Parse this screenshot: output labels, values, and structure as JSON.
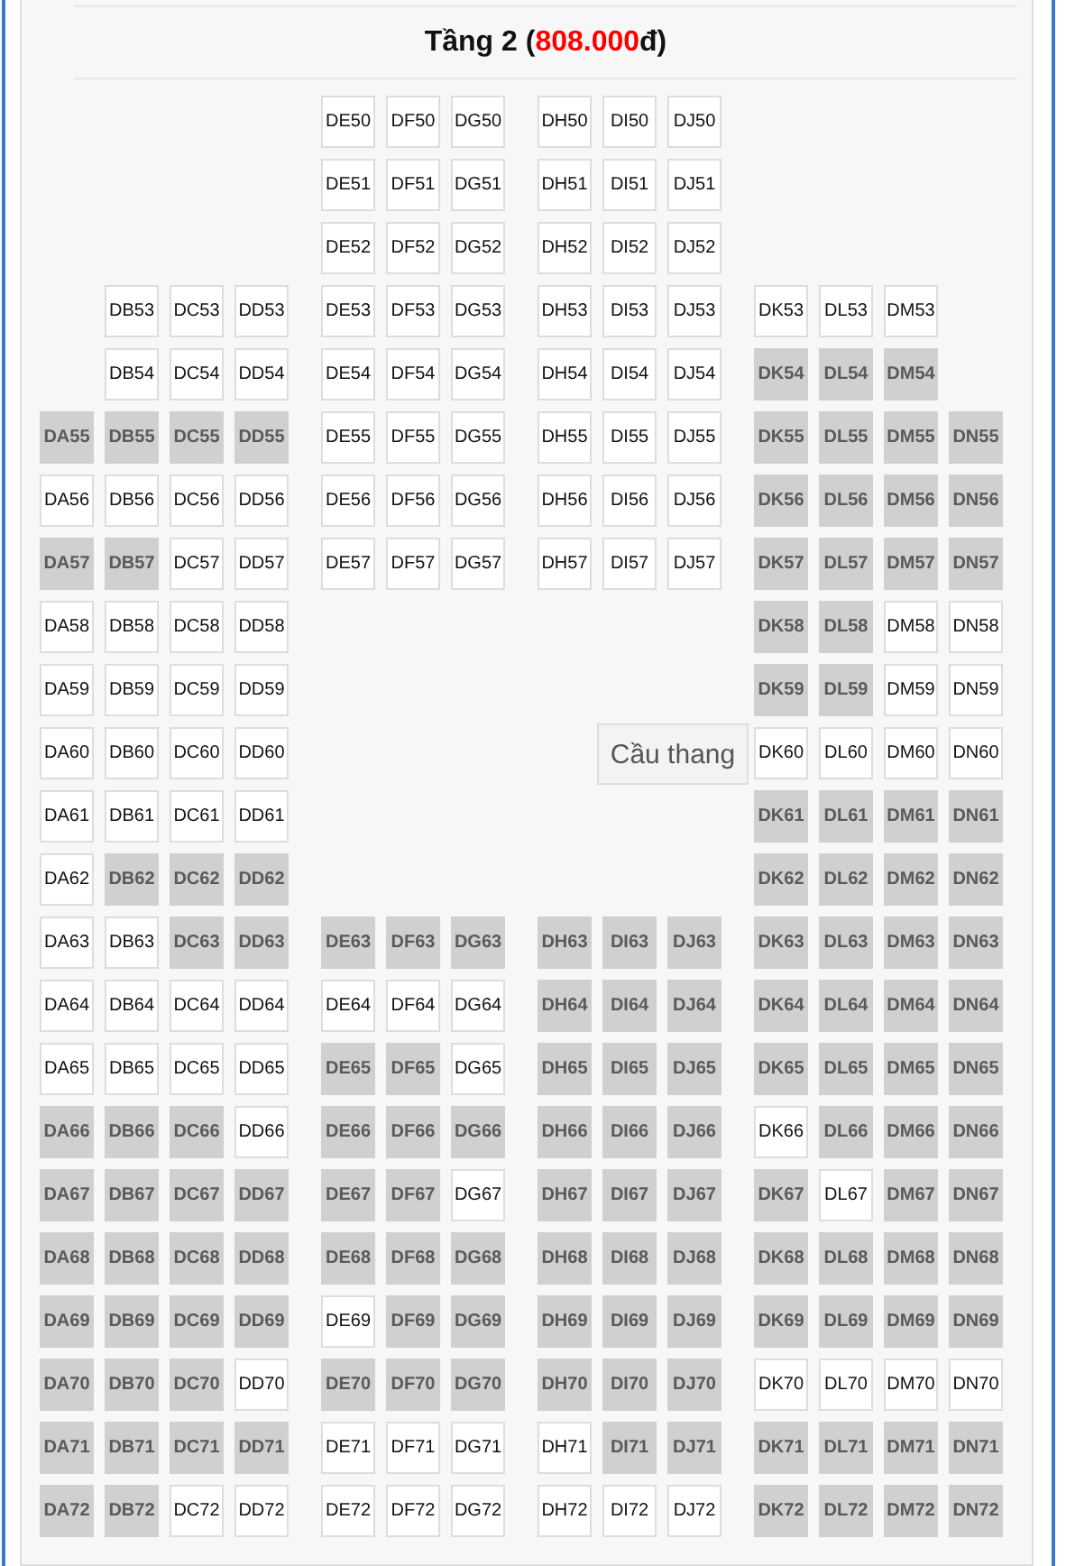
{
  "heading": {
    "title": "Tầng 2 (",
    "price": "808.000",
    "title_end": "đ)"
  },
  "rows": [
    {
      "center_a": [
        {
          "label": "DE50",
          "available": true
        },
        {
          "label": "DF50",
          "available": true
        },
        {
          "label": "DG50",
          "available": true
        }
      ],
      "center_b": [
        {
          "label": "DH50",
          "available": true
        },
        {
          "label": "DI50",
          "available": true
        },
        {
          "label": "DJ50",
          "available": true
        }
      ]
    },
    {
      "center_a": [
        {
          "label": "DE51",
          "available": true
        },
        {
          "label": "DF51",
          "available": true
        },
        {
          "label": "DG51",
          "available": true
        }
      ],
      "center_b": [
        {
          "label": "DH51",
          "available": true
        },
        {
          "label": "DI51",
          "available": true
        },
        {
          "label": "DJ51",
          "available": true
        }
      ]
    },
    {
      "center_a": [
        {
          "label": "DE52",
          "available": true
        },
        {
          "label": "DF52",
          "available": true
        },
        {
          "label": "DG52",
          "available": true
        }
      ],
      "center_b": [
        {
          "label": "DH52",
          "available": true
        },
        {
          "label": "DI52",
          "available": true
        },
        {
          "label": "DJ52",
          "available": true
        }
      ]
    },
    {
      "left": [
        {
          "label": "DB53",
          "available": true
        },
        {
          "label": "DC53",
          "available": true
        },
        {
          "label": "DD53",
          "available": true
        }
      ],
      "center_a": [
        {
          "label": "DE53",
          "available": true
        },
        {
          "label": "DF53",
          "available": true
        },
        {
          "label": "DG53",
          "available": true
        }
      ],
      "center_b": [
        {
          "label": "DH53",
          "available": true
        },
        {
          "label": "DI53",
          "available": true
        },
        {
          "label": "DJ53",
          "available": true
        }
      ],
      "right": [
        {
          "label": "DK53",
          "available": true
        },
        {
          "label": "DL53",
          "available": true
        },
        {
          "label": "DM53",
          "available": true
        }
      ]
    },
    {
      "left": [
        {
          "label": "DB54",
          "available": true
        },
        {
          "label": "DC54",
          "available": true
        },
        {
          "label": "DD54",
          "available": true
        }
      ],
      "center_a": [
        {
          "label": "DE54",
          "available": true
        },
        {
          "label": "DF54",
          "available": true
        },
        {
          "label": "DG54",
          "available": true
        }
      ],
      "center_b": [
        {
          "label": "DH54",
          "available": true
        },
        {
          "label": "DI54",
          "available": true
        },
        {
          "label": "DJ54",
          "available": true
        }
      ],
      "right": [
        {
          "label": "DK54",
          "available": false
        },
        {
          "label": "DL54",
          "available": false
        },
        {
          "label": "DM54",
          "available": false
        }
      ]
    },
    {
      "left": [
        {
          "label": "DA55",
          "available": false
        },
        {
          "label": "DB55",
          "available": false
        },
        {
          "label": "DC55",
          "available": false
        },
        {
          "label": "DD55",
          "available": false
        }
      ],
      "center_a": [
        {
          "label": "DE55",
          "available": true
        },
        {
          "label": "DF55",
          "available": true
        },
        {
          "label": "DG55",
          "available": true
        }
      ],
      "center_b": [
        {
          "label": "DH55",
          "available": true
        },
        {
          "label": "DI55",
          "available": true
        },
        {
          "label": "DJ55",
          "available": true
        }
      ],
      "right": [
        {
          "label": "DK55",
          "available": false
        },
        {
          "label": "DL55",
          "available": false
        },
        {
          "label": "DM55",
          "available": false
        },
        {
          "label": "DN55",
          "available": false
        }
      ]
    },
    {
      "left": [
        {
          "label": "DA56",
          "available": true
        },
        {
          "label": "DB56",
          "available": true
        },
        {
          "label": "DC56",
          "available": true
        },
        {
          "label": "DD56",
          "available": true
        }
      ],
      "center_a": [
        {
          "label": "DE56",
          "available": true
        },
        {
          "label": "DF56",
          "available": true
        },
        {
          "label": "DG56",
          "available": true
        }
      ],
      "center_b": [
        {
          "label": "DH56",
          "available": true
        },
        {
          "label": "DI56",
          "available": true
        },
        {
          "label": "DJ56",
          "available": true
        }
      ],
      "right": [
        {
          "label": "DK56",
          "available": false
        },
        {
          "label": "DL56",
          "available": false
        },
        {
          "label": "DM56",
          "available": false
        },
        {
          "label": "DN56",
          "available": false
        }
      ]
    },
    {
      "left": [
        {
          "label": "DA57",
          "available": false
        },
        {
          "label": "DB57",
          "available": false
        },
        {
          "label": "DC57",
          "available": true
        },
        {
          "label": "DD57",
          "available": true
        }
      ],
      "center_a": [
        {
          "label": "DE57",
          "available": true
        },
        {
          "label": "DF57",
          "available": true
        },
        {
          "label": "DG57",
          "available": true
        }
      ],
      "center_b": [
        {
          "label": "DH57",
          "available": true
        },
        {
          "label": "DI57",
          "available": true
        },
        {
          "label": "DJ57",
          "available": true
        }
      ],
      "right": [
        {
          "label": "DK57",
          "available": false
        },
        {
          "label": "DL57",
          "available": false
        },
        {
          "label": "DM57",
          "available": false
        },
        {
          "label": "DN57",
          "available": false
        }
      ]
    },
    {
      "left": [
        {
          "label": "DA58",
          "available": true
        },
        {
          "label": "DB58",
          "available": true
        },
        {
          "label": "DC58",
          "available": true
        },
        {
          "label": "DD58",
          "available": true
        }
      ],
      "right": [
        {
          "label": "DK58",
          "available": false
        },
        {
          "label": "DL58",
          "available": false
        },
        {
          "label": "DM58",
          "available": true
        },
        {
          "label": "DN58",
          "available": true
        }
      ]
    },
    {
      "left": [
        {
          "label": "DA59",
          "available": true
        },
        {
          "label": "DB59",
          "available": true
        },
        {
          "label": "DC59",
          "available": true
        },
        {
          "label": "DD59",
          "available": true
        }
      ],
      "right": [
        {
          "label": "DK59",
          "available": false
        },
        {
          "label": "DL59",
          "available": false
        },
        {
          "label": "DM59",
          "available": true
        },
        {
          "label": "DN59",
          "available": true
        }
      ]
    },
    {
      "left": [
        {
          "label": "DA60",
          "available": true
        },
        {
          "label": "DB60",
          "available": true
        },
        {
          "label": "DC60",
          "available": true
        },
        {
          "label": "DD60",
          "available": true
        }
      ],
      "stairs": "Cầu thang",
      "right": [
        {
          "label": "DK60",
          "available": true
        },
        {
          "label": "DL60",
          "available": true
        },
        {
          "label": "DM60",
          "available": true
        },
        {
          "label": "DN60",
          "available": true
        }
      ]
    },
    {
      "left": [
        {
          "label": "DA61",
          "available": true
        },
        {
          "label": "DB61",
          "available": true
        },
        {
          "label": "DC61",
          "available": true
        },
        {
          "label": "DD61",
          "available": true
        }
      ],
      "right": [
        {
          "label": "DK61",
          "available": false
        },
        {
          "label": "DL61",
          "available": false
        },
        {
          "label": "DM61",
          "available": false
        },
        {
          "label": "DN61",
          "available": false
        }
      ]
    },
    {
      "left": [
        {
          "label": "DA62",
          "available": true
        },
        {
          "label": "DB62",
          "available": false
        },
        {
          "label": "DC62",
          "available": false
        },
        {
          "label": "DD62",
          "available": false
        }
      ],
      "right": [
        {
          "label": "DK62",
          "available": false
        },
        {
          "label": "DL62",
          "available": false
        },
        {
          "label": "DM62",
          "available": false
        },
        {
          "label": "DN62",
          "available": false
        }
      ]
    },
    {
      "left": [
        {
          "label": "DA63",
          "available": true
        },
        {
          "label": "DB63",
          "available": true
        },
        {
          "label": "DC63",
          "available": false
        },
        {
          "label": "DD63",
          "available": false
        }
      ],
      "center_a": [
        {
          "label": "DE63",
          "available": false
        },
        {
          "label": "DF63",
          "available": false
        },
        {
          "label": "DG63",
          "available": false
        }
      ],
      "center_b": [
        {
          "label": "DH63",
          "available": false
        },
        {
          "label": "DI63",
          "available": false
        },
        {
          "label": "DJ63",
          "available": false
        }
      ],
      "right": [
        {
          "label": "DK63",
          "available": false
        },
        {
          "label": "DL63",
          "available": false
        },
        {
          "label": "DM63",
          "available": false
        },
        {
          "label": "DN63",
          "available": false
        }
      ]
    },
    {
      "left": [
        {
          "label": "DA64",
          "available": true
        },
        {
          "label": "DB64",
          "available": true
        },
        {
          "label": "DC64",
          "available": true
        },
        {
          "label": "DD64",
          "available": true
        }
      ],
      "center_a": [
        {
          "label": "DE64",
          "available": true
        },
        {
          "label": "DF64",
          "available": true
        },
        {
          "label": "DG64",
          "available": true
        }
      ],
      "center_b": [
        {
          "label": "DH64",
          "available": false
        },
        {
          "label": "DI64",
          "available": false
        },
        {
          "label": "DJ64",
          "available": false
        }
      ],
      "right": [
        {
          "label": "DK64",
          "available": false
        },
        {
          "label": "DL64",
          "available": false
        },
        {
          "label": "DM64",
          "available": false
        },
        {
          "label": "DN64",
          "available": false
        }
      ]
    },
    {
      "left": [
        {
          "label": "DA65",
          "available": true
        },
        {
          "label": "DB65",
          "available": true
        },
        {
          "label": "DC65",
          "available": true
        },
        {
          "label": "DD65",
          "available": true
        }
      ],
      "center_a": [
        {
          "label": "DE65",
          "available": false
        },
        {
          "label": "DF65",
          "available": false
        },
        {
          "label": "DG65",
          "available": true
        }
      ],
      "center_b": [
        {
          "label": "DH65",
          "available": false
        },
        {
          "label": "DI65",
          "available": false
        },
        {
          "label": "DJ65",
          "available": false
        }
      ],
      "right": [
        {
          "label": "DK65",
          "available": false
        },
        {
          "label": "DL65",
          "available": false
        },
        {
          "label": "DM65",
          "available": false
        },
        {
          "label": "DN65",
          "available": false
        }
      ]
    },
    {
      "left": [
        {
          "label": "DA66",
          "available": false
        },
        {
          "label": "DB66",
          "available": false
        },
        {
          "label": "DC66",
          "available": false
        },
        {
          "label": "DD66",
          "available": true
        }
      ],
      "center_a": [
        {
          "label": "DE66",
          "available": false
        },
        {
          "label": "DF66",
          "available": false
        },
        {
          "label": "DG66",
          "available": false
        }
      ],
      "center_b": [
        {
          "label": "DH66",
          "available": false
        },
        {
          "label": "DI66",
          "available": false
        },
        {
          "label": "DJ66",
          "available": false
        }
      ],
      "right": [
        {
          "label": "DK66",
          "available": true
        },
        {
          "label": "DL66",
          "available": false
        },
        {
          "label": "DM66",
          "available": false
        },
        {
          "label": "DN66",
          "available": false
        }
      ]
    },
    {
      "left": [
        {
          "label": "DA67",
          "available": false
        },
        {
          "label": "DB67",
          "available": false
        },
        {
          "label": "DC67",
          "available": false
        },
        {
          "label": "DD67",
          "available": false
        }
      ],
      "center_a": [
        {
          "label": "DE67",
          "available": false
        },
        {
          "label": "DF67",
          "available": false
        },
        {
          "label": "DG67",
          "available": true
        }
      ],
      "center_b": [
        {
          "label": "DH67",
          "available": false
        },
        {
          "label": "DI67",
          "available": false
        },
        {
          "label": "DJ67",
          "available": false
        }
      ],
      "right": [
        {
          "label": "DK67",
          "available": false
        },
        {
          "label": "DL67",
          "available": true
        },
        {
          "label": "DM67",
          "available": false
        },
        {
          "label": "DN67",
          "available": false
        }
      ]
    },
    {
      "left": [
        {
          "label": "DA68",
          "available": false
        },
        {
          "label": "DB68",
          "available": false
        },
        {
          "label": "DC68",
          "available": false
        },
        {
          "label": "DD68",
          "available": false
        }
      ],
      "center_a": [
        {
          "label": "DE68",
          "available": false
        },
        {
          "label": "DF68",
          "available": false
        },
        {
          "label": "DG68",
          "available": false
        }
      ],
      "center_b": [
        {
          "label": "DH68",
          "available": false
        },
        {
          "label": "DI68",
          "available": false
        },
        {
          "label": "DJ68",
          "available": false
        }
      ],
      "right": [
        {
          "label": "DK68",
          "available": false
        },
        {
          "label": "DL68",
          "available": false
        },
        {
          "label": "DM68",
          "available": false
        },
        {
          "label": "DN68",
          "available": false
        }
      ]
    },
    {
      "left": [
        {
          "label": "DA69",
          "available": false
        },
        {
          "label": "DB69",
          "available": false
        },
        {
          "label": "DC69",
          "available": false
        },
        {
          "label": "DD69",
          "available": false
        }
      ],
      "center_a": [
        {
          "label": "DE69",
          "available": true
        },
        {
          "label": "DF69",
          "available": false
        },
        {
          "label": "DG69",
          "available": false
        }
      ],
      "center_b": [
        {
          "label": "DH69",
          "available": false
        },
        {
          "label": "DI69",
          "available": false
        },
        {
          "label": "DJ69",
          "available": false
        }
      ],
      "right": [
        {
          "label": "DK69",
          "available": false
        },
        {
          "label": "DL69",
          "available": false
        },
        {
          "label": "DM69",
          "available": false
        },
        {
          "label": "DN69",
          "available": false
        }
      ]
    },
    {
      "left": [
        {
          "label": "DA70",
          "available": false
        },
        {
          "label": "DB70",
          "available": false
        },
        {
          "label": "DC70",
          "available": false
        },
        {
          "label": "DD70",
          "available": true
        }
      ],
      "center_a": [
        {
          "label": "DE70",
          "available": false
        },
        {
          "label": "DF70",
          "available": false
        },
        {
          "label": "DG70",
          "available": false
        }
      ],
      "center_b": [
        {
          "label": "DH70",
          "available": false
        },
        {
          "label": "DI70",
          "available": false
        },
        {
          "label": "DJ70",
          "available": false
        }
      ],
      "right": [
        {
          "label": "DK70",
          "available": true
        },
        {
          "label": "DL70",
          "available": true
        },
        {
          "label": "DM70",
          "available": true
        },
        {
          "label": "DN70",
          "available": true
        }
      ]
    },
    {
      "left": [
        {
          "label": "DA71",
          "available": false
        },
        {
          "label": "DB71",
          "available": false
        },
        {
          "label": "DC71",
          "available": false
        },
        {
          "label": "DD71",
          "available": false
        }
      ],
      "center_a": [
        {
          "label": "DE71",
          "available": true
        },
        {
          "label": "DF71",
          "available": true
        },
        {
          "label": "DG71",
          "available": true
        }
      ],
      "center_b": [
        {
          "label": "DH71",
          "available": true
        },
        {
          "label": "DI71",
          "available": false
        },
        {
          "label": "DJ71",
          "available": false
        }
      ],
      "right": [
        {
          "label": "DK71",
          "available": false
        },
        {
          "label": "DL71",
          "available": false
        },
        {
          "label": "DM71",
          "available": false
        },
        {
          "label": "DN71",
          "available": false
        }
      ]
    },
    {
      "left": [
        {
          "label": "DA72",
          "available": false
        },
        {
          "label": "DB72",
          "available": false
        },
        {
          "label": "DC72",
          "available": true
        },
        {
          "label": "DD72",
          "available": true
        }
      ],
      "center_a": [
        {
          "label": "DE72",
          "available": true
        },
        {
          "label": "DF72",
          "available": true
        },
        {
          "label": "DG72",
          "available": true
        }
      ],
      "center_b": [
        {
          "label": "DH72",
          "available": true
        },
        {
          "label": "DI72",
          "available": true
        },
        {
          "label": "DJ72",
          "available": true
        }
      ],
      "right": [
        {
          "label": "DK72",
          "available": false
        },
        {
          "label": "DL72",
          "available": false
        },
        {
          "label": "DM72",
          "available": false
        },
        {
          "label": "DN72",
          "available": false
        }
      ]
    }
  ]
}
